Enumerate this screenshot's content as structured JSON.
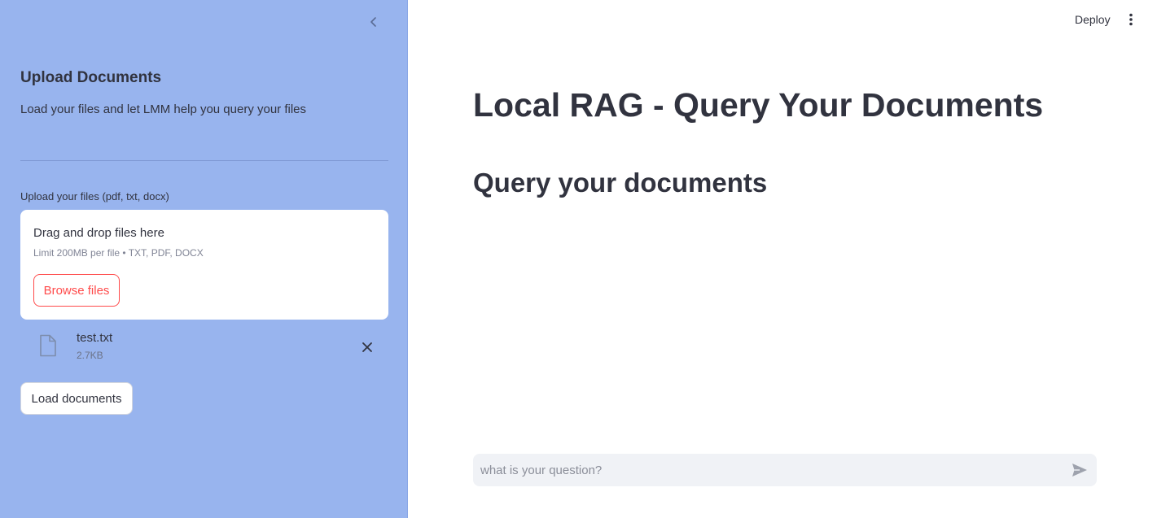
{
  "header": {
    "deploy_label": "Deploy",
    "menu_icon": "vertical-ellipsis-icon"
  },
  "sidebar": {
    "collapse_icon": "chevron-left-icon",
    "title": "Upload Documents",
    "description": "Load your files and let LMM help you query your files",
    "uploader": {
      "label": "Upload your files (pdf, txt, docx)",
      "drop_title": "Drag and drop files here",
      "limit_text": "Limit 200MB per file • TXT, PDF, DOCX",
      "browse_label": "Browse files"
    },
    "files": [
      {
        "name": "test.txt",
        "size": "2.7KB",
        "icon": "file-icon",
        "remove_icon": "close-icon"
      }
    ],
    "load_button_label": "Load documents"
  },
  "main": {
    "title": "Local RAG - Query Your Documents",
    "subtitle": "Query your documents"
  },
  "chat": {
    "placeholder": "what is your question?",
    "value": "",
    "send_icon": "send-icon"
  },
  "colors": {
    "sidebar_bg": "#98b4ee",
    "accent": "#ff4b4b",
    "text": "#31333f",
    "input_bg": "#f0f2f6"
  }
}
